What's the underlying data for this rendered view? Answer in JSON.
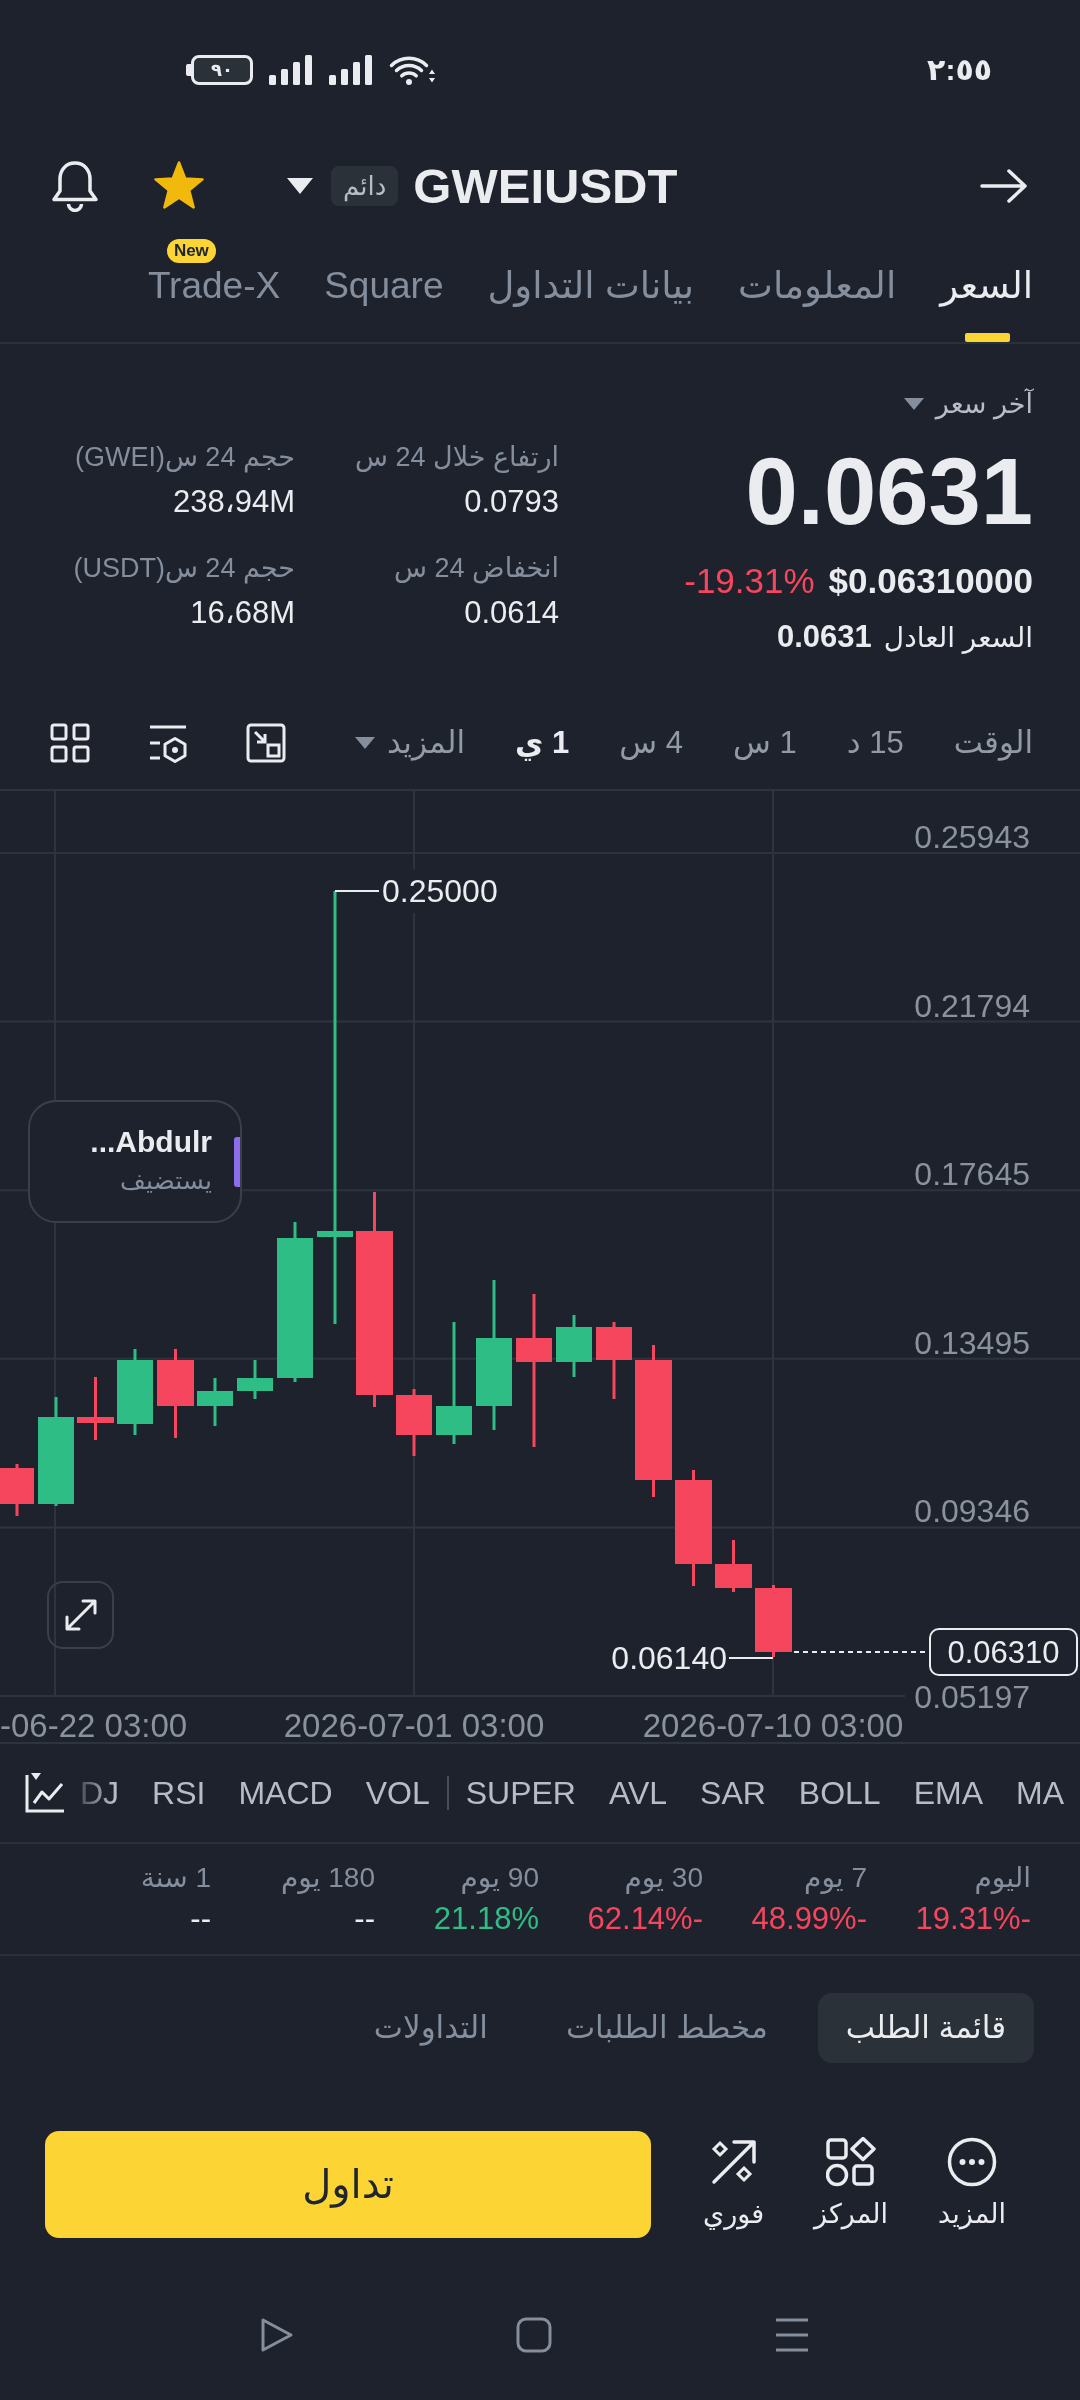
{
  "status_bar": {
    "time": "٢:٥٥",
    "battery": "٩٠"
  },
  "header": {
    "symbol": "GWEIUSDT",
    "badge": "دائم",
    "favorite": true
  },
  "tabs": [
    {
      "label": "السعر",
      "selected": true
    },
    {
      "label": "المعلومات",
      "selected": false
    },
    {
      "label": "بيانات التداول",
      "selected": false
    },
    {
      "label": "Square",
      "selected": false
    },
    {
      "label": "Trade-X",
      "selected": false,
      "badge": "New"
    }
  ],
  "price": {
    "type_label": "آخر سعر",
    "last": "0.0631",
    "usd_value": "$0.06310000",
    "change": {
      "text": "-19.31%",
      "color": "#f6465d"
    },
    "fair_label": "السعر العادل",
    "fair_value": "0.0631"
  },
  "stats": [
    {
      "label": "ارتفاع خلال 24 س",
      "value": "0.0793"
    },
    {
      "label": "حجم 24 س(GWEI)",
      "value": "238،94M"
    },
    {
      "label": "انخفاض 24 س",
      "value": "0.0614"
    },
    {
      "label": "حجم 24 س(USDT)",
      "value": "16،68M"
    }
  ],
  "timeframes": [
    {
      "label": "الوقت",
      "selected": false
    },
    {
      "label": "15 د",
      "selected": false
    },
    {
      "label": "1 س",
      "selected": false
    },
    {
      "label": "4 س",
      "selected": false
    },
    {
      "label": "1 ي",
      "selected": true
    }
  ],
  "more_button": "المزيد",
  "chart": {
    "y_axis": [
      "0.25943",
      "0.21794",
      "0.17645",
      "0.13495",
      "0.09346",
      "0.05197"
    ],
    "x_axis": [
      "2026-07-10 03:00",
      "2026-07-01 03:00",
      "-06-22 03:00"
    ],
    "high_label": "0.25000",
    "low_label": "0.06140",
    "last_price": "0.06310",
    "live_card": {
      "name": "Abdulr...",
      "status": "يستضيف"
    }
  },
  "indicator_groups": [
    [
      "MA",
      "EMA",
      "BOLL",
      "SAR",
      "AVL",
      "SUPER"
    ],
    [
      "VOL",
      "MACD",
      "RSI",
      "DJ"
    ]
  ],
  "performance": [
    {
      "period": "اليوم",
      "value": "-19.31%",
      "color": "#f6465d"
    },
    {
      "period": "7 يوم",
      "value": "-48.99%",
      "color": "#f6465d"
    },
    {
      "period": "30 يوم",
      "value": "-62.14%",
      "color": "#f6465d"
    },
    {
      "period": "90 يوم",
      "value": "21.18%",
      "color": "#2ebd85"
    },
    {
      "period": "180 يوم",
      "value": "--",
      "color": "#eaecef"
    },
    {
      "period": "1 سنة",
      "value": "--",
      "color": "#eaecef"
    }
  ],
  "book_tabs": [
    {
      "label": "قائمة الطلب",
      "selected": true
    },
    {
      "label": "مخطط الطلبات",
      "selected": false
    },
    {
      "label": "التداولات",
      "selected": false
    }
  ],
  "trade_button": "تداول",
  "actions": [
    {
      "label": "المزيد",
      "kind": "more"
    },
    {
      "label": "المركز",
      "kind": "positions"
    },
    {
      "label": "فوري",
      "kind": "instant"
    }
  ]
}
